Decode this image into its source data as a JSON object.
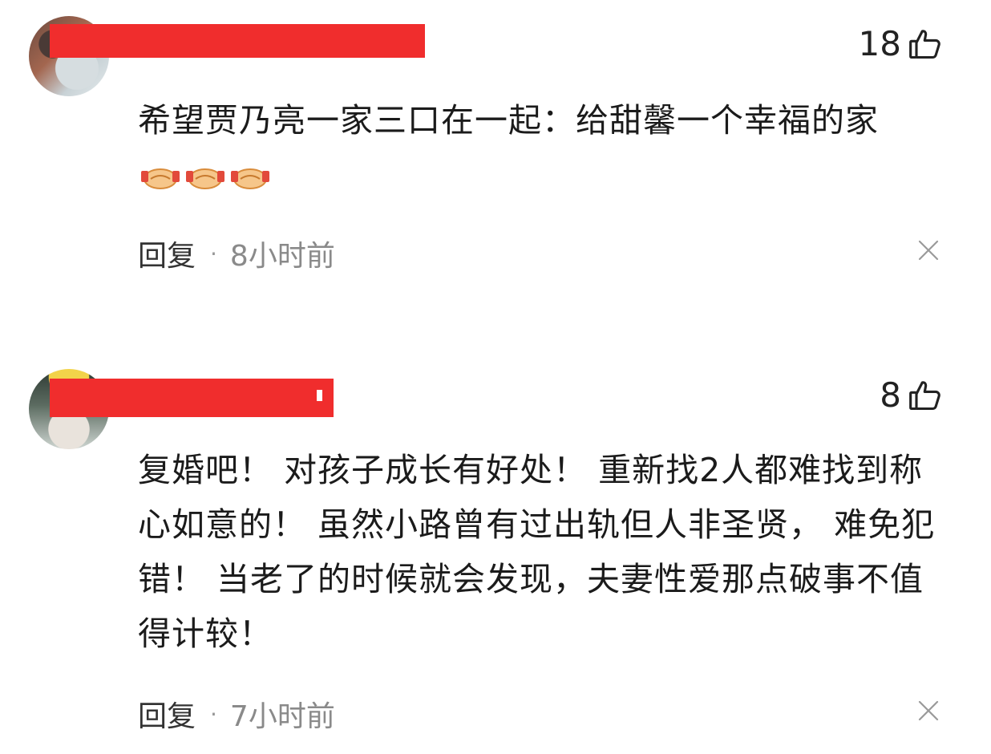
{
  "comments": [
    {
      "likes": "18",
      "text": "希望贾乃亮一家三口在一起：给甜馨一个幸福的家",
      "reply_label": "回复",
      "separator": "·",
      "time": "8小时前"
    },
    {
      "likes": "8",
      "text": "复婚吧！ 对孩子成长有好处！ 重新找2人都难找到称心如意的！ 虽然小路曾有过出轨但人非圣贤， 难免犯错！ 当老了的时候就会发现，夫妻性爱那点破事不值得计较！",
      "reply_label": "回复",
      "separator": "·",
      "time": "7小时前"
    }
  ],
  "icons": {
    "like": "thumbs-up-icon",
    "close": "close-icon",
    "emoji": "handshake-emoji"
  },
  "colors": {
    "redaction": "#f02d2d",
    "meta_gray": "#8a8a8a"
  }
}
